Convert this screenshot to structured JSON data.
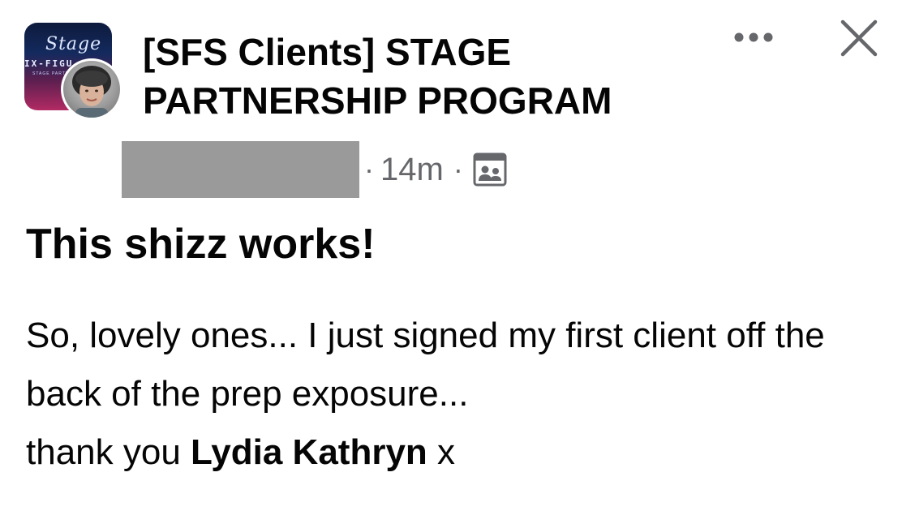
{
  "header": {
    "group_name": "[SFS Clients] STAGE PARTNERSHIP PROGRAM",
    "group_avatar": {
      "logo_script": "Stage",
      "logo_strap": "IX-FIGU",
      "logo_small": "STAGE PARTN"
    },
    "timestamp": "14m",
    "separator": "·",
    "audience_icon": "group-members-icon",
    "more_icon": "more-options-icon",
    "close_icon": "close-icon"
  },
  "post": {
    "title": "This shizz works!",
    "body_text": "So, lovely ones... I just signed my first client off the back of the prep exposure...",
    "thanks_prefix": "thank you",
    "mention": "Lydia Kathryn",
    "thanks_suffix": "x"
  },
  "colors": {
    "text_primary": "#050505",
    "text_secondary": "#65676b",
    "redaction": "#9a9a9a",
    "background": "#ffffff"
  }
}
